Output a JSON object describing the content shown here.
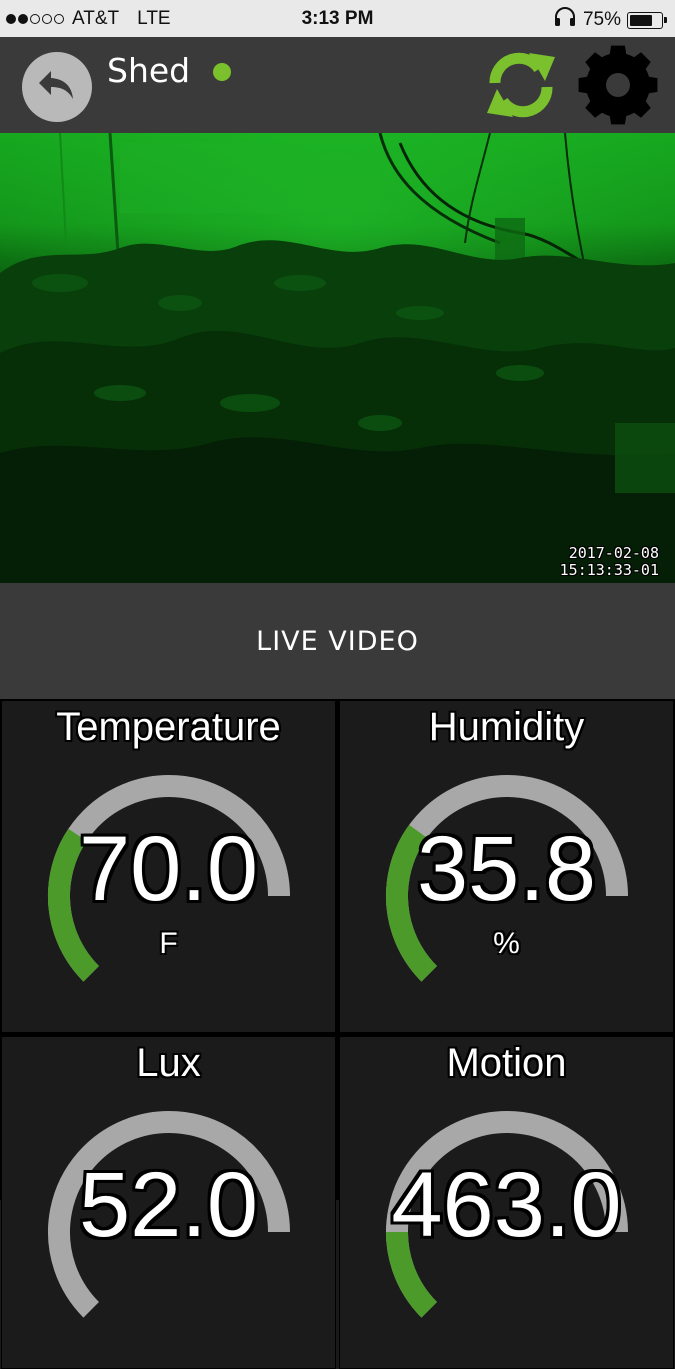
{
  "status_bar": {
    "signal_bars": 2,
    "carrier": "AT&T",
    "network": "LTE",
    "time": "3:13 PM",
    "headphones_icon": "headphones-icon",
    "battery_percent": "75%",
    "battery_level": 0.75
  },
  "header": {
    "back_icon": "back-arrow-icon",
    "title": "Shed",
    "online_color": "#7bc12e",
    "refresh_icon": "refresh-icon",
    "settings_icon": "gear-icon",
    "accent_color": "#7bc12e"
  },
  "video": {
    "date": "2017-02-08",
    "time": "15:13:33-01"
  },
  "live_video_label": "LIVE VIDEO",
  "sensors": [
    {
      "name": "Temperature",
      "value": "70.0",
      "unit": "F",
      "fraction": 0.35
    },
    {
      "name": "Humidity",
      "value": "35.8",
      "unit": "%",
      "fraction": 0.36
    },
    {
      "name": "Lux",
      "value": "52.0",
      "unit": "",
      "fraction": 0.0
    },
    {
      "name": "Motion",
      "value": "463.0",
      "unit": "",
      "fraction": 0.2
    }
  ],
  "gauge_colors": {
    "track": "#a8a8a8",
    "fill": "#4c9a2a"
  }
}
